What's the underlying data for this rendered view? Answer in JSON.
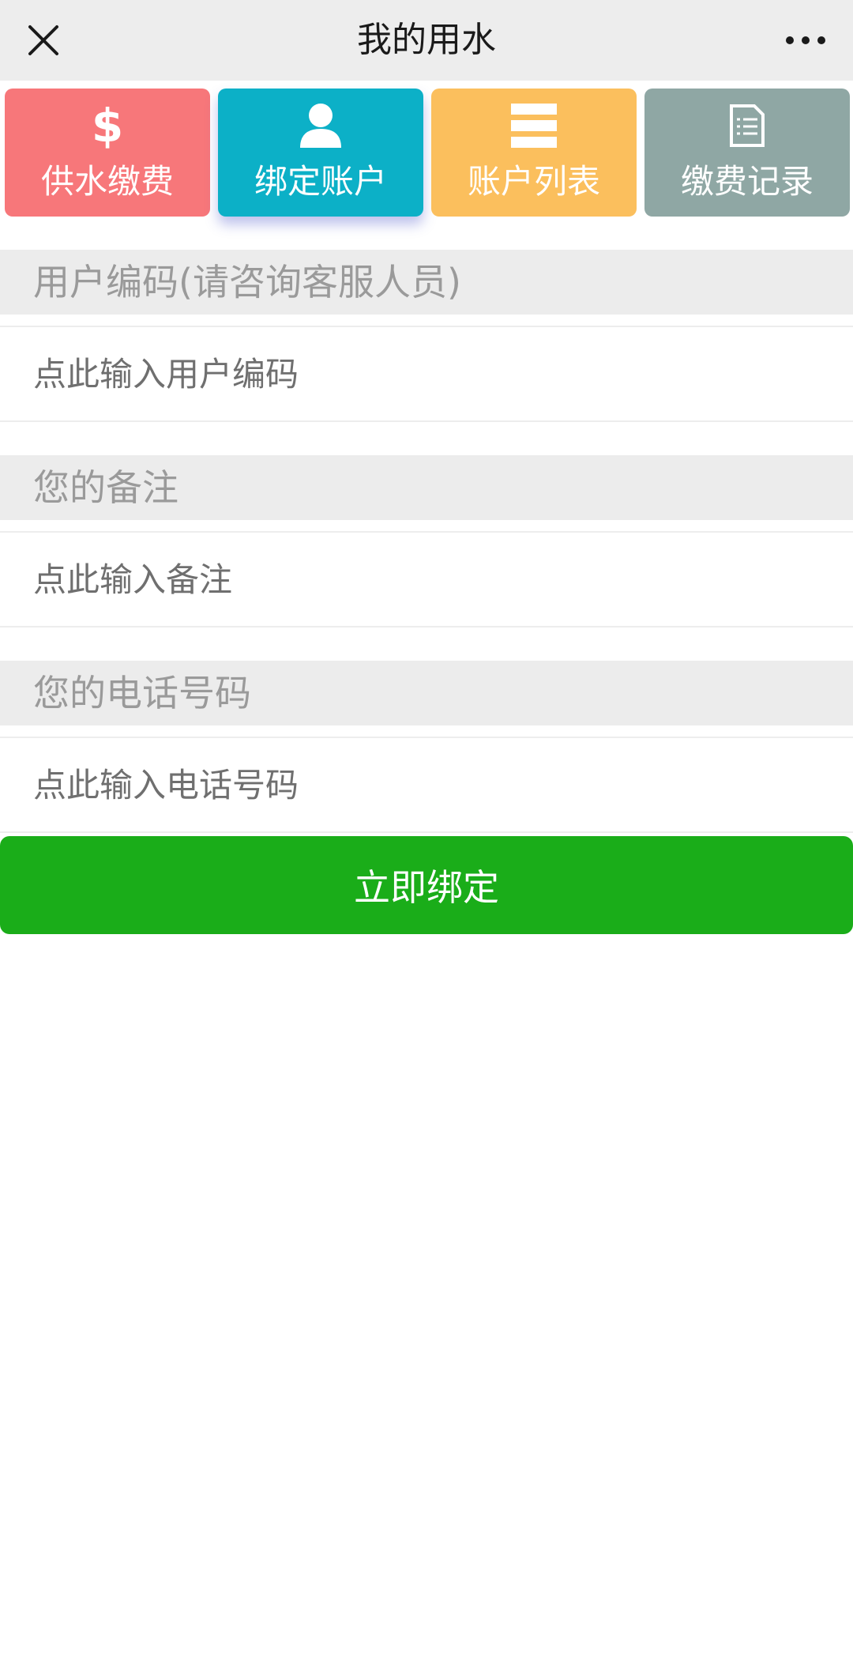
{
  "header": {
    "title": "我的用水"
  },
  "tiles": [
    {
      "label": "供水缴费",
      "icon": "dollar-icon",
      "color": "#f7777a"
    },
    {
      "label": "绑定账户",
      "icon": "user-icon",
      "color": "#0cb0c7"
    },
    {
      "label": "账户列表",
      "icon": "list-icon",
      "color": "#fbbf5d"
    },
    {
      "label": "缴费记录",
      "icon": "document-icon",
      "color": "#8fa7a4"
    }
  ],
  "form": {
    "user_code": {
      "label": "用户编码(请咨询客服人员)",
      "placeholder": "点此输入用户编码"
    },
    "remark": {
      "label": "您的备注",
      "placeholder": "点此输入备注"
    },
    "phone": {
      "label": "您的电话号码",
      "placeholder": "点此输入电话号码"
    },
    "submit_label": "立即绑定",
    "submit_color": "#1aad19"
  }
}
